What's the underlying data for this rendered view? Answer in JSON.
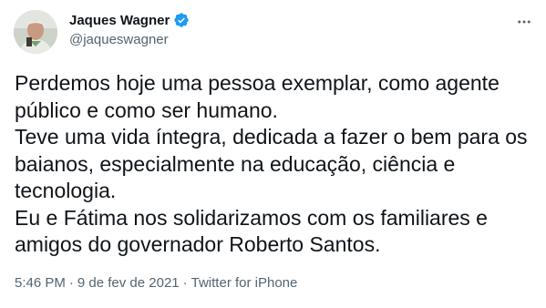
{
  "tweet": {
    "author": {
      "name": "Jaques Wagner",
      "handle": "@jaqueswagner",
      "avatar_icon": "profile-photo",
      "verified_icon": "verified-badge-icon",
      "verified_color": "#1d9bf0"
    },
    "more_icon": "more-options-icon",
    "text": "Perdemos hoje uma pessoa exemplar, como agente\npúblico e como ser humano.\nTeve uma vida íntegra, dedicada a fazer o bem para os\nbaianos, especialmente na educação, ciência e\ntecnologia.\nEu e Fátima nos solidarizamos com os familiares e\namigos do governador Roberto Santos.",
    "meta": {
      "time": "5:46 PM",
      "separator": "·",
      "date": "9 de fev de 2021",
      "source": "Twitter for iPhone"
    }
  }
}
